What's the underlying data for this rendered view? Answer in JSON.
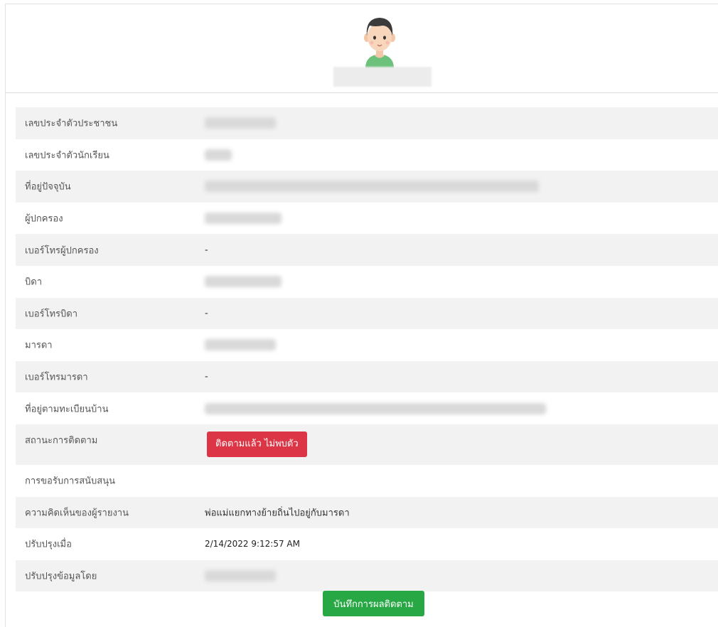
{
  "profile": {
    "avatar_icon": "student-avatar-icon"
  },
  "rows": [
    {
      "label": "เลขประจำตัวประชาชน",
      "value": "",
      "blurred": true
    },
    {
      "label": "เลขประจำตัวนักเรียน",
      "value": "",
      "blurred": true
    },
    {
      "label": "ที่อยู่ปัจจุบัน",
      "value": "",
      "blurred": true
    },
    {
      "label": "ผู้ปกครอง",
      "value": "",
      "blurred": true
    },
    {
      "label": "เบอร์โทรผู้ปกครอง",
      "value": "-"
    },
    {
      "label": "บิดา",
      "value": "",
      "blurred": true
    },
    {
      "label": "เบอร์โทรบิดา",
      "value": "-"
    },
    {
      "label": "มารดา",
      "value": "",
      "blurred": true
    },
    {
      "label": "เบอร์โทรมารดา",
      "value": "-"
    },
    {
      "label": "ที่อยู่ตามทะเบียนบ้าน",
      "value": "",
      "blurred": true
    },
    {
      "label": "สถานะการติดตาม",
      "status_label": "ติดตามแล้ว ไม่พบตัว",
      "status_color": "#dc3545"
    },
    {
      "label": "การขอรับการสนับสนุน",
      "value": ""
    },
    {
      "label": "ความคิดเห็นของผู้รายงาน",
      "value": "พ่อแม่แยกทางย้ายถิ่นไปอยู่กับมารดา"
    },
    {
      "label": "ปรับปรุงเมื่อ",
      "value": "2/14/2022 9:12:57 AM"
    },
    {
      "label": "ปรับปรุงข้อมูลโดย",
      "value": "",
      "blurred": true
    }
  ],
  "actions": {
    "save_label": "บันทึกการผลติดตาม",
    "save_color": "#28a745"
  }
}
